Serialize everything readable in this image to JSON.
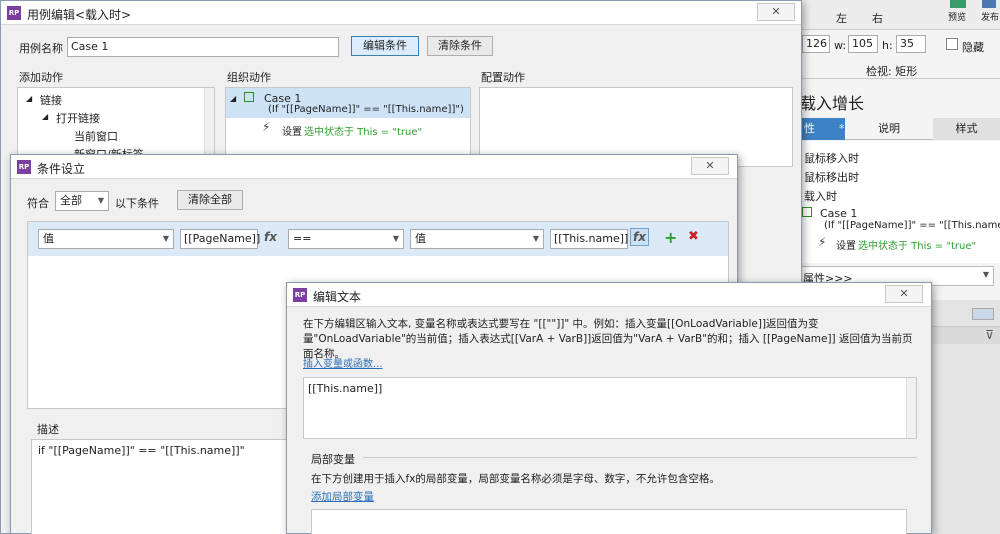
{
  "right": {
    "top_left_label": "左",
    "top_right_label": "右",
    "preview_label": "预览",
    "publish_label": "发布",
    "x_value": "126",
    "w_label": "w:",
    "w_value": "105",
    "h_label": "h:",
    "h_value": "35",
    "hide_label": "隐藏",
    "view_label": "检视: 矩形",
    "heading": "载入增长",
    "tab_property": "性",
    "tab_note": "说明",
    "tab_style": "样式",
    "events": [
      "鼠标移入时",
      "鼠标移出时",
      "载入时"
    ],
    "case_name": "Case 1",
    "case_condition": "(If \"[[PageName]]\" == \"[[This.name]]\")",
    "action_prefix": "设置",
    "action_text": "选中状态于 This = \"true\"",
    "more_events": "属性>>>"
  },
  "case_editor": {
    "title": "用例编辑<载入时>",
    "name_label": "用例名称",
    "name_value": "Case 1",
    "edit_condition_btn": "编辑条件",
    "clear_condition_btn": "清除条件",
    "add_action_label": "添加动作",
    "organize_action_label": "组织动作",
    "config_action_label": "配置动作",
    "tree": [
      "链接",
      "打开链接",
      "当前窗口",
      "新窗口/新标签"
    ],
    "org_case": "Case 1",
    "org_condition": "(If \"[[PageName]]\" == \"[[This.name]]\")",
    "org_action_prefix": "设置",
    "org_action": "选中状态于 This = \"true\""
  },
  "condition": {
    "title": "条件设立",
    "match_label": "符合",
    "match_value": "全部",
    "following_label": "以下条件",
    "clear_all_btn": "清除全部",
    "row": {
      "left_type": "值",
      "left_value": "[[PageName]]",
      "fx": "fx",
      "operator": "==",
      "right_type": "值",
      "right_value": "[[This.name]]",
      "fx2": "fx"
    },
    "desc_label": "描述",
    "desc_text": "if \"[[PageName]]\" == \"[[This.name]]\""
  },
  "edit_text": {
    "title": "编辑文本",
    "instruction": "在下方编辑区输入文本, 变量名称或表达式要写在 \"[[\"\"]]\" 中。例如：插入变量[[OnLoadVariable]]返回值为变量\"OnLoadVariable\"的当前值；插入表达式[[VarA + VarB]]返回值为\"VarA + VarB\"的和；插入 [[PageName]] 返回值为当前页面名称。",
    "insert_link": "插入变量或函数...",
    "editor_text": "[[This.name]]",
    "local_var_heading": "局部变量",
    "local_var_desc": "在下方创建用于插入fx的局部变量，局部变量名称必须是字母、数字，不允许包含空格。",
    "add_local_link": "添加局部变量"
  }
}
